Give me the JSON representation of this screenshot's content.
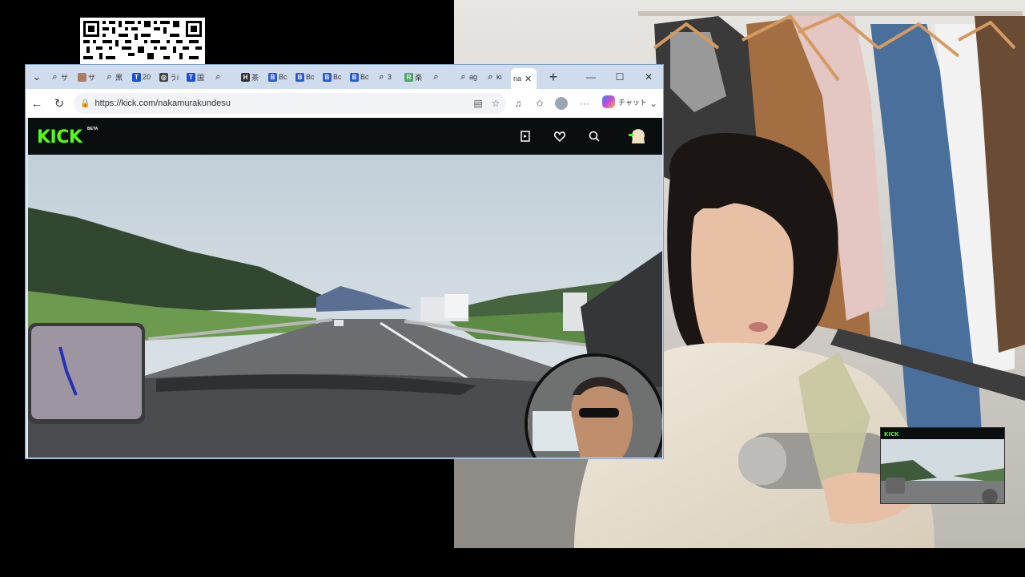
{
  "browser": {
    "tabs": [
      {
        "label": "サ",
        "fav_color": "#5f6d7e",
        "fav_glyph": "🔍"
      },
      {
        "label": "サ",
        "fav_color": "#b07a62",
        "fav_glyph": ""
      },
      {
        "label": "黒",
        "fav_color": "#5f6d7e",
        "fav_glyph": "🔍"
      },
      {
        "label": "20",
        "fav_color": "#1a4fd6",
        "fav_glyph": "T"
      },
      {
        "label": "うi",
        "fav_color": "#444444",
        "fav_glyph": "◎"
      },
      {
        "label": "国",
        "fav_color": "#1a4fd6",
        "fav_glyph": "T"
      },
      {
        "label": "",
        "fav_color": "#5f6d7e",
        "fav_glyph": "🔍"
      },
      {
        "label": "茶",
        "fav_color": "#333333",
        "fav_glyph": "H"
      },
      {
        "label": "Bc",
        "fav_color": "#2a5bd7",
        "fav_glyph": "B"
      },
      {
        "label": "Bc",
        "fav_color": "#2a5bd7",
        "fav_glyph": "B"
      },
      {
        "label": "Bc",
        "fav_color": "#2a5bd7",
        "fav_glyph": "B"
      },
      {
        "label": "Bc",
        "fav_color": "#2a5bd7",
        "fav_glyph": "B"
      },
      {
        "label": "3",
        "fav_color": "#5f6d7e",
        "fav_glyph": "🔍"
      },
      {
        "label": "楽",
        "fav_color": "#4fa36a",
        "fav_glyph": "R"
      },
      {
        "label": "",
        "fav_color": "#5f6d7e",
        "fav_glyph": "🔍"
      },
      {
        "label": "ag",
        "fav_color": "#5f6d7e",
        "fav_glyph": "🔍"
      },
      {
        "label": "ki",
        "fav_color": "#5f6d7e",
        "fav_glyph": "🔍"
      }
    ],
    "active_tab": {
      "label": "na"
    },
    "new_tab": "+",
    "window": {
      "minimize": "—",
      "maximize": "☐",
      "close": "✕"
    },
    "url": "https://kick.com/nakamurakundesu",
    "chat_label": "チャット"
  },
  "kick": {
    "logo": "KICK",
    "beta": "BETA",
    "brand_color": "#53fc18"
  }
}
